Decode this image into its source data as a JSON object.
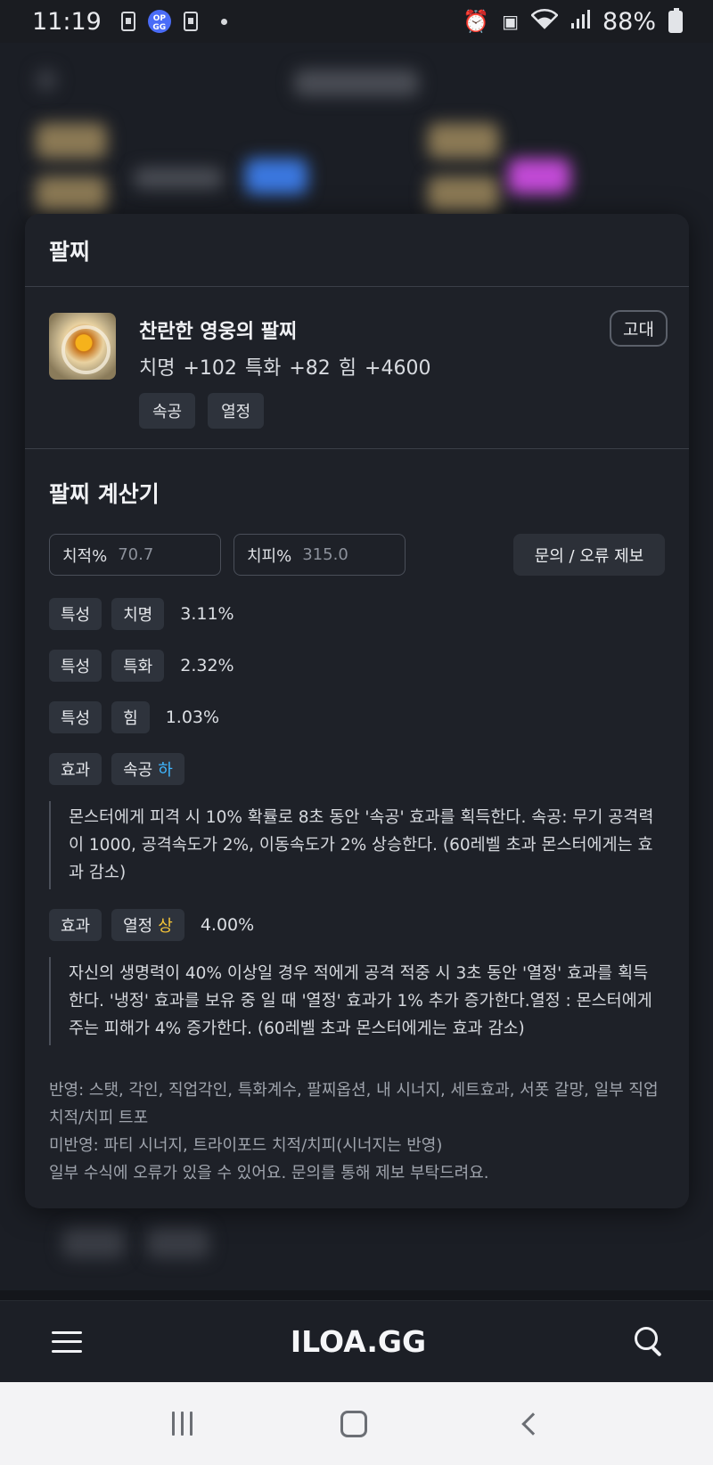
{
  "status_bar": {
    "time": "11:19",
    "battery": "88%",
    "icons": [
      "sim-card-icon",
      "opgg-app-icon",
      "sim-card-icon",
      "notification-dot-icon",
      "alarm-icon",
      "battery-saver-icon",
      "wifi-icon",
      "signal-icon",
      "battery-charging-icon"
    ]
  },
  "modal": {
    "title": "팔찌",
    "item": {
      "name": "찬란한 영웅의 팔찌",
      "stats": "치명 +102  특화 +82  힘 +4600",
      "grade": "고대",
      "tags": [
        "속공",
        "열정"
      ]
    },
    "calculator": {
      "title": "팔찌 계산기",
      "crit_rate_label": "치적%",
      "crit_rate_value": "70.7",
      "crit_dmg_label": "치피%",
      "crit_dmg_value": "315.0",
      "report_button": "문의 / 오류 제보",
      "traits": [
        {
          "type": "특성",
          "name": "치명",
          "value": "3.11%"
        },
        {
          "type": "특성",
          "name": "특화",
          "value": "2.32%"
        },
        {
          "type": "특성",
          "name": "힘",
          "value": "1.03%"
        }
      ],
      "effects": [
        {
          "type": "효과",
          "name": "속공",
          "grade": "하",
          "value": "",
          "description": "몬스터에게 피격 시 10% 확률로 8초 동안 '속공' 효과를 획득한다. 속공: 무기 공격력이 1000, 공격속도가 2%, 이동속도가 2% 상승한다. (60레벨 초과 몬스터에게는 효과 감소)"
        },
        {
          "type": "효과",
          "name": "열정",
          "grade": "상",
          "value": "4.00%",
          "description": "자신의 생명력이 40% 이상일 경우 적에게 공격 적중 시 3초 동안 '열정' 효과를 획득한다. '냉정' 효과를 보유 중 일 때 '열정' 효과가 1% 추가 증가한다.열정 : 몬스터에게 주는 피해가 4% 증가한다. (60레벨 초과 몬스터에게는 효과 감소)"
        }
      ],
      "notes": [
        "반영: 스탯, 각인, 직업각인, 특화계수, 팔찌옵션, 내 시너지, 세트효과, 서폿 갈망, 일부 직업 치적/치피 트포",
        "미반영: 파티 시너지, 트라이포드 치적/치피(시너지는 반영)",
        "일부 수식에 오류가 있을 수 있어요. 문의를 통해 제보 부탁드려요."
      ]
    }
  },
  "app_bar": {
    "brand": "ILOA.GG",
    "menu_icon": "hamburger-menu-icon",
    "search_icon": "search-icon"
  },
  "colors": {
    "background": "#14161b",
    "modal": "#1e2128",
    "chip": "#2e333c",
    "grade_low": "#3fb6ff",
    "grade_high": "#f5c438"
  }
}
